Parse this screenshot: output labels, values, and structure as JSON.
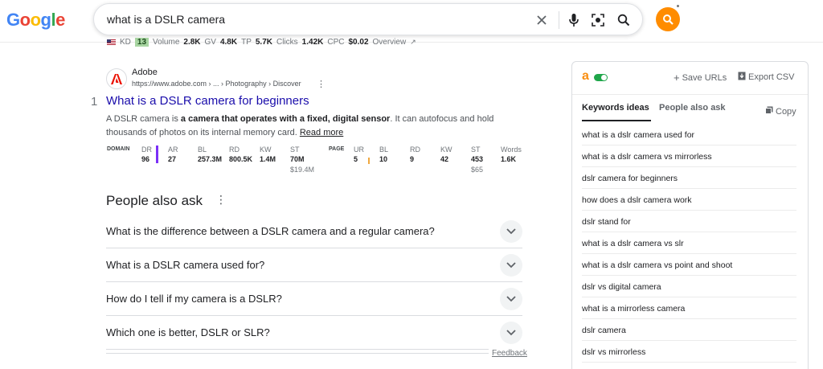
{
  "search": {
    "query": "what is a DSLR camera"
  },
  "logo": {
    "text": "Google",
    "colors": [
      "#4285f4",
      "#ea4335",
      "#fbbc05",
      "#4285f4",
      "#34a853",
      "#ea4335"
    ]
  },
  "keyword_strip": {
    "kd_label": "KD",
    "kd_value": "13",
    "volume_label": "Volume",
    "volume_value": "2.8K",
    "gv_label": "GV",
    "gv_value": "4.8K",
    "tp_label": "TP",
    "tp_value": "5.7K",
    "clicks_label": "Clicks",
    "clicks_value": "1.42K",
    "cpc_label": "CPC",
    "cpc_value": "$0.02",
    "overview_label": "Overview"
  },
  "result": {
    "number": "1",
    "site_name": "Adobe",
    "url": "https://www.adobe.com › ... › Photography › Discover",
    "title": "What is a DSLR camera for beginners",
    "snippet_pre": "A DSLR camera is ",
    "snippet_bold": "a camera that operates with a fixed, digital sensor",
    "snippet_post": ". It can autofocus and hold thousands of photos on its internal memory card.",
    "read_more": "Read more",
    "domain_metrics": {
      "section_label": "DOMAIN",
      "dr_label": "DR",
      "dr_value": "96",
      "ar_label": "AR",
      "ar_value": "27",
      "bl_label": "BL",
      "bl_value": "257.3M",
      "rd_label": "RD",
      "rd_value": "800.5K",
      "kw_label": "KW",
      "kw_value": "1.4M",
      "st_label": "ST",
      "st_value": "70M",
      "st_sub": "$19.4M"
    },
    "page_metrics": {
      "section_label": "PAGE",
      "ur_label": "UR",
      "ur_value": "5",
      "bl_label": "BL",
      "bl_value": "10",
      "rd_label": "RD",
      "rd_value": "9",
      "kw_label": "KW",
      "kw_value": "42",
      "st_label": "ST",
      "st_value": "453",
      "st_sub": "$65",
      "words_label": "Words",
      "words_value": "1.6K"
    }
  },
  "people_also_ask": {
    "title": "People also ask",
    "questions": [
      "What is the difference between a DSLR camera and a regular camera?",
      "What is a DSLR camera used for?",
      "How do I tell if my camera is a DSLR?",
      "Which one is better, DSLR or SLR?"
    ],
    "feedback": "Feedback"
  },
  "panel": {
    "logo_letter": "a",
    "save_urls": "Save URLs",
    "export_csv": "Export CSV",
    "tab_keywords": "Keywords ideas",
    "tab_paa": "People also ask",
    "copy": "Copy",
    "keywords": [
      "what is a dslr camera used for",
      "what is a dslr camera vs mirrorless",
      "dslr camera for beginners",
      "how does a dslr camera work",
      "dslr stand for",
      "what is a dslr camera vs slr",
      "what is a dslr camera vs point and shoot",
      "dslr vs digital camera",
      "what is a mirrorless camera",
      "dslr camera",
      "dslr vs mirrorless"
    ]
  }
}
